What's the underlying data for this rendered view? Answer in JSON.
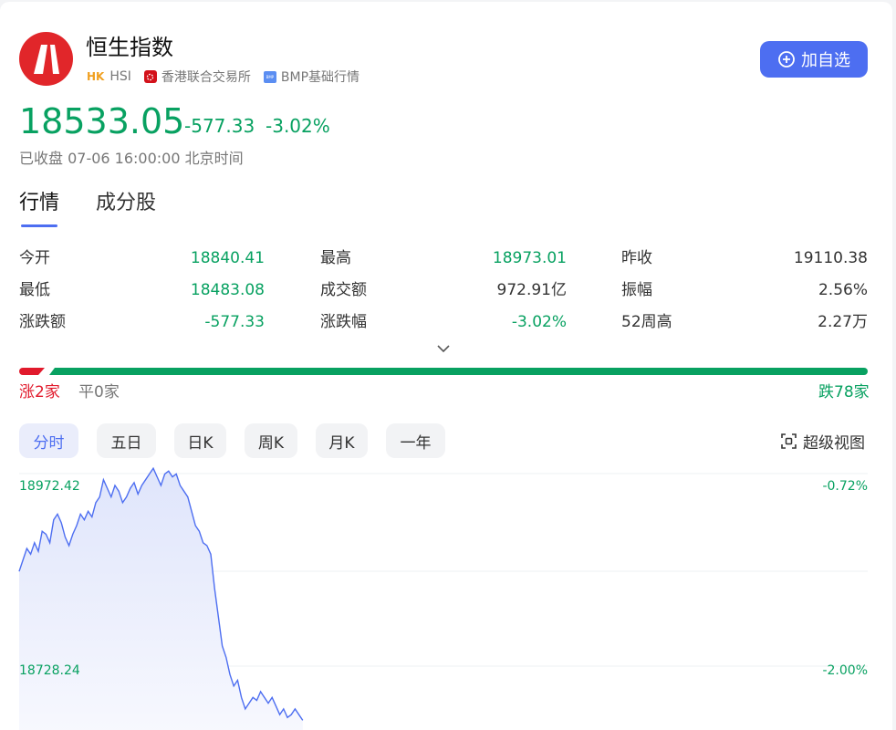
{
  "header": {
    "title": "恒生指数",
    "market": "HK",
    "code": "HSI",
    "exchange": "香港联合交易所",
    "data_source": "BMP基础行情",
    "add_button_label": "加自选"
  },
  "quote": {
    "price": "18533.05",
    "change": "-577.33",
    "change_pct": "-3.02%",
    "status": "已收盘 07-06 16:00:00 北京时间"
  },
  "tabs": [
    "行情",
    "成分股"
  ],
  "stats": {
    "rows": [
      [
        {
          "label": "今开",
          "value": "18840.41"
        },
        {
          "label": "最高",
          "value": "18973.01"
        },
        {
          "label": "昨收",
          "value": "19110.38"
        }
      ],
      [
        {
          "label": "最低",
          "value": "18483.08"
        },
        {
          "label": "成交额",
          "value": "972.91亿"
        },
        {
          "label": "振幅",
          "value": "2.56%"
        }
      ],
      [
        {
          "label": "涨跌额",
          "value": "-577.33"
        },
        {
          "label": "涨跌幅",
          "value": "-3.02%"
        },
        {
          "label": "52周高",
          "value": "2.27万"
        }
      ]
    ]
  },
  "breadth": {
    "rise_label": "涨2家",
    "flat_label": "平0家",
    "fall_label": "跌78家",
    "rise": 2,
    "flat": 0,
    "fall": 78
  },
  "chart_toolbar": {
    "periods": [
      "分时",
      "五日",
      "日K",
      "周K",
      "月K",
      "一年"
    ],
    "active_period": "分时",
    "super_view_label": "超级视图"
  },
  "chart_data": {
    "type": "area",
    "y_left_labels": [
      "18972.42",
      "18728.24"
    ],
    "y_right_labels": [
      "-0.72%",
      "-2.00%"
    ],
    "ylim": [
      18600,
      19030
    ],
    "values": [
      18880,
      18900,
      18920,
      18910,
      18930,
      18915,
      18950,
      18945,
      18930,
      18970,
      18980,
      18965,
      18940,
      18925,
      18945,
      18960,
      18980,
      18970,
      18985,
      18975,
      19000,
      19010,
      19040,
      19025,
      19010,
      19030,
      19020,
      19000,
      19010,
      19025,
      19035,
      19015,
      19030,
      19040,
      19050,
      19060,
      19045,
      19030,
      19050,
      19055,
      19045,
      19050,
      19030,
      19020,
      19010,
      18985,
      18960,
      18950,
      18930,
      18925,
      18910,
      18850,
      18800,
      18750,
      18730,
      18700,
      18680,
      18690,
      18660,
      18640,
      18650,
      18660,
      18655,
      18670,
      18660,
      18650,
      18660,
      18645,
      18630,
      18640,
      18625,
      18630,
      18640,
      18630,
      18620
    ]
  }
}
